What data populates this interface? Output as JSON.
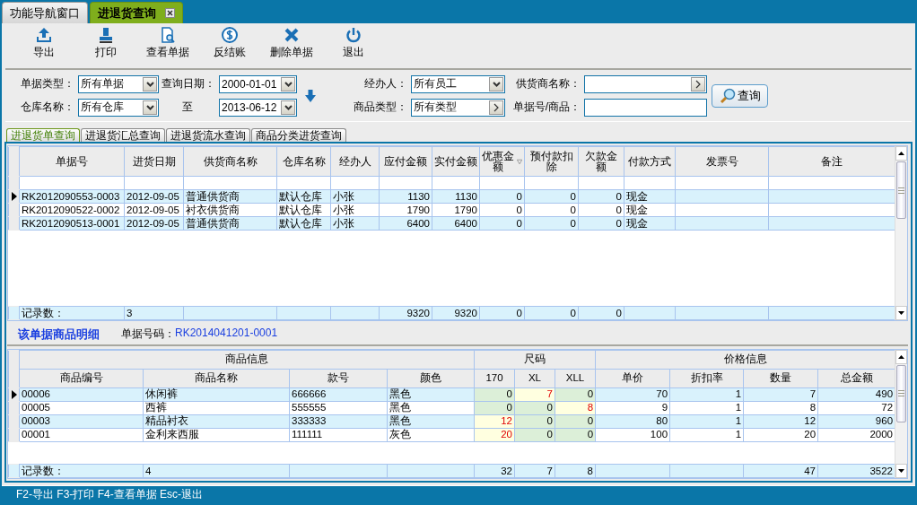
{
  "tabs": [
    {
      "label": "功能导航窗口",
      "selected": false,
      "closable": false
    },
    {
      "label": "进退货查询",
      "selected": true,
      "closable": true
    }
  ],
  "toolbar": [
    {
      "kind": "export",
      "label": "导出"
    },
    {
      "kind": "print",
      "label": "打印"
    },
    {
      "kind": "view",
      "label": "查看单据"
    },
    {
      "kind": "unsettle",
      "label": "反结账"
    },
    {
      "kind": "delete",
      "label": "删除单据"
    },
    {
      "kind": "exit",
      "label": "退出"
    }
  ],
  "filters": [
    {
      "label": "单据类型：",
      "kind": "select",
      "value": "所有单据"
    },
    {
      "label": "查询日期：",
      "kind": "select",
      "value": "2000-01-01"
    },
    {
      "label": "经办人：",
      "kind": "select",
      "value": "所有员工"
    },
    {
      "label": "供货商名称：",
      "kind": "lookup"
    },
    {
      "label": "仓库名称：",
      "kind": "select",
      "value": "所有仓库"
    },
    {
      "label": "至",
      "kind": "select",
      "value": "2013-06-12"
    },
    {
      "label": "商品类型：",
      "kind": "lookup",
      "value": "所有类型"
    },
    {
      "label": "单据号/商品：",
      "kind": "text"
    }
  ],
  "query_button": {
    "label": "查询"
  },
  "sub_tabs": [
    {
      "label": "进退货单查询",
      "selected": true
    },
    {
      "label": "进退货汇总查询",
      "selected": false
    },
    {
      "label": "进退货流水查询",
      "selected": false
    },
    {
      "label": "商品分类进货查询",
      "selected": false
    }
  ],
  "orders": {
    "columns": [
      {
        "label": "单据号",
        "kind": "text",
        "sorted": false
      },
      {
        "label": "进货日期",
        "kind": "text",
        "sorted": false
      },
      {
        "label": "供货商名称",
        "kind": "text",
        "sorted": false
      },
      {
        "label": "仓库名称",
        "kind": "text",
        "sorted": false
      },
      {
        "label": "经办人",
        "kind": "text",
        "sorted": false
      },
      {
        "label": "应付金额",
        "kind": "number",
        "sorted": false
      },
      {
        "label": "实付金额",
        "kind": "number",
        "sorted": false
      },
      {
        "label": "优惠金额",
        "kind": "number",
        "sorted": true
      },
      {
        "label": "预付款扣除",
        "kind": "number",
        "sorted": false
      },
      {
        "label": "欠款金额",
        "kind": "number",
        "sorted": false
      },
      {
        "label": "付款方式",
        "kind": "text",
        "sorted": false
      },
      {
        "label": "发票号",
        "kind": "text",
        "sorted": false
      },
      {
        "label": "备注",
        "kind": "text",
        "sorted": false
      }
    ],
    "rows": [
      {
        "selected": true,
        "cells": [
          "RK2012090553-0003",
          "2012-09-05",
          "普通供货商",
          "默认仓库",
          "小张",
          "1130",
          "1130",
          "0",
          "0",
          "0",
          "现金"
        ]
      },
      {
        "selected": false,
        "cells": [
          "RK2012090522-0002",
          "2012-09-05",
          "衬衣供货商",
          "默认仓库",
          "小张",
          "1790",
          "1790",
          "0",
          "0",
          "0",
          "现金"
        ]
      },
      {
        "selected": false,
        "cells": [
          "RK2012090513-0001",
          "2012-09-05",
          "普通供货商",
          "默认仓库",
          "小张",
          "6400",
          "6400",
          "0",
          "0",
          "0",
          "现金"
        ]
      }
    ],
    "footer": {
      "label": "记录数：",
      "count": "3",
      "payable": "9320",
      "paid": "9320",
      "discount": "0",
      "prepaid": "0",
      "owed": "0"
    }
  },
  "detail": {
    "title": "该单据商品明细",
    "doc_label": "单据号码：",
    "doc_no": "RK2014041201-0001"
  },
  "items": {
    "groups": [
      "商品信息",
      "尺码",
      "价格信息"
    ],
    "columns": [
      "商品编号",
      "商品名称",
      "款号",
      "颜色",
      "170",
      "XL",
      "XLL",
      "单价",
      "折扣率",
      "数量",
      "总金额"
    ],
    "rows": [
      {
        "selected": true,
        "code": "00006",
        "name": "休闲裤",
        "style_no": "666666",
        "color_name": "黑色",
        "sizes": [
          {
            "qty": "0",
            "flagged": false
          },
          {
            "qty": "7",
            "flagged": true
          },
          {
            "qty": "0",
            "flagged": false
          }
        ],
        "price": "70",
        "discount": "1",
        "quantity": "7",
        "total": "490"
      },
      {
        "selected": false,
        "code": "00005",
        "name": "西裤",
        "style_no": "555555",
        "color_name": "黑色",
        "sizes": [
          {
            "qty": "0",
            "flagged": false
          },
          {
            "qty": "0",
            "flagged": false
          },
          {
            "qty": "8",
            "flagged": true
          }
        ],
        "price": "9",
        "discount": "1",
        "quantity": "8",
        "total": "72"
      },
      {
        "selected": false,
        "code": "00003",
        "name": "精品衬衣",
        "style_no": "333333",
        "color_name": "黑色",
        "sizes": [
          {
            "qty": "12",
            "flagged": true
          },
          {
            "qty": "0",
            "flagged": false
          },
          {
            "qty": "0",
            "flagged": false
          }
        ],
        "price": "80",
        "discount": "1",
        "quantity": "12",
        "total": "960"
      },
      {
        "selected": false,
        "code": "00001",
        "name": "金利来西服",
        "style_no": "111111",
        "color_name": "灰色",
        "sizes": [
          {
            "qty": "20",
            "flagged": true
          },
          {
            "qty": "0",
            "flagged": false
          },
          {
            "qty": "0",
            "flagged": false
          }
        ],
        "price": "100",
        "discount": "1",
        "quantity": "20",
        "total": "2000"
      }
    ],
    "footer": {
      "label": "记录数：",
      "count": "4",
      "sizes": [
        "32",
        "7",
        "8"
      ],
      "quantity": "47",
      "total": "3522"
    }
  },
  "status_bar": "F2-导出 F3-打印 F4-查看单据 Esc-退出"
}
